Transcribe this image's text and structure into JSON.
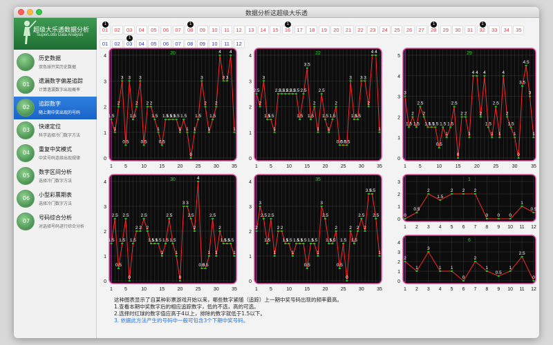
{
  "window": {
    "title": "数据分析这超级大乐透"
  },
  "logo": {
    "title": "超级大乐透数据分析",
    "subtitle": "SuperLotto Data Analysis"
  },
  "nav": [
    {
      "label": "历史数据",
      "sub": "双色球开奖历史数据",
      "icon": "clock-icon",
      "glyph": ""
    },
    {
      "label": "遗漏数字偏差追踪",
      "sub": "计算遗漏数字出现概率",
      "icon": "omission-icon",
      "glyph": "01"
    },
    {
      "label": "追踪数字",
      "sub": "随上期中奖出现的号码",
      "icon": "tracking-icon",
      "glyph": "02"
    },
    {
      "label": "快速定位",
      "sub": "科学选择冷门数字方法",
      "icon": "locate-icon",
      "glyph": "03"
    },
    {
      "label": "重复中奖模式",
      "sub": "中奖号码连续出现规律",
      "icon": "repeat-icon",
      "glyph": "04"
    },
    {
      "label": "数字区间分析",
      "sub": "选择冷门数字方法",
      "icon": "range-icon",
      "glyph": "05"
    },
    {
      "label": "小型彩票期表",
      "sub": "选择冷门数字方法",
      "icon": "table-icon",
      "glyph": "06"
    },
    {
      "label": "号码综合分析",
      "sub": "对选择号码进行综合分析",
      "icon": "analysis-icon",
      "glyph": "07"
    }
  ],
  "active_nav_index": 2,
  "front_numbers": [
    "01",
    "02",
    "03",
    "04",
    "05",
    "06",
    "07",
    "08",
    "09",
    "10",
    "11",
    "12",
    "13",
    "14",
    "15",
    "16",
    "17",
    "18",
    "19",
    "20",
    "21",
    "22",
    "23",
    "24",
    "25",
    "26",
    "27",
    "28",
    "29",
    "30",
    "31",
    "32",
    "33",
    "34",
    "35"
  ],
  "back_numbers": [
    "01",
    "02",
    "03",
    "04",
    "05",
    "06",
    "07",
    "08",
    "09",
    "10",
    "11",
    "12"
  ],
  "front_markers": [
    {
      "number": "01",
      "label": "1"
    },
    {
      "number": "08",
      "label": "1"
    },
    {
      "number": "16",
      "label": "1"
    },
    {
      "number": "28",
      "label": "1"
    },
    {
      "number": "32",
      "label": "1"
    }
  ],
  "back_markers": [
    {
      "number": "03",
      "label": "1"
    }
  ],
  "colors": {
    "red": "#e33333",
    "blue": "#2233cc",
    "accent": "#1a64c8",
    "chart_bg": "#0c0c0c",
    "chart_border": "#e64aa0",
    "line": "#ff2a2a",
    "label": "#ffffff",
    "marker": "#19c21e"
  },
  "chart_data": [
    {
      "type": "line",
      "title": "20",
      "xticks": [
        1,
        5,
        10,
        15,
        20,
        25,
        30,
        35
      ],
      "ylim": [
        0,
        4
      ],
      "yticks": [
        0,
        1,
        2,
        3,
        4
      ],
      "values": [
        1.5,
        1,
        2,
        3,
        0.5,
        3,
        1.5,
        2,
        3,
        0.5,
        2,
        2,
        1.5,
        1,
        0.5,
        1.5,
        1.5,
        1.5,
        1.5,
        1,
        1.5,
        1,
        0,
        1,
        1.5,
        3,
        2,
        1,
        1.5,
        2,
        4,
        3,
        3,
        4,
        1
      ]
    },
    {
      "type": "line",
      "title": "22",
      "xticks": [
        1,
        5,
        10,
        15,
        20,
        25,
        30,
        35
      ],
      "ylim": [
        0,
        4
      ],
      "yticks": [
        0,
        1,
        2,
        3,
        4
      ],
      "values": [
        2.5,
        2,
        3,
        1.5,
        1.5,
        1,
        2.5,
        2.5,
        2.5,
        2.5,
        2.5,
        2.5,
        1.5,
        2.5,
        3.5,
        1.5,
        2,
        1,
        2.5,
        1.5,
        1,
        1.5,
        2,
        0.5,
        0.5,
        0.5,
        3,
        1.5,
        1.5,
        3,
        3,
        2,
        4,
        4,
        1
      ]
    },
    {
      "type": "line",
      "title": "29",
      "xticks": [
        1,
        5,
        10,
        15,
        20,
        25,
        30,
        35
      ],
      "ylim": [
        0,
        5
      ],
      "yticks": [
        0,
        1,
        2,
        3,
        4,
        5
      ],
      "values": [
        3,
        1.5,
        2,
        1.5,
        2.5,
        2,
        1.5,
        1.5,
        1.5,
        0.5,
        1.5,
        1,
        1.5,
        2.5,
        0,
        2,
        2,
        1,
        4,
        4,
        2,
        4,
        1.5,
        1,
        2.5,
        1,
        4,
        2,
        1.5,
        1,
        0,
        3.5,
        4.5,
        3,
        1
      ]
    },
    {
      "type": "line",
      "title": "30",
      "xticks": [
        1,
        5,
        10,
        15,
        20,
        25,
        30,
        35
      ],
      "ylim": [
        0,
        4
      ],
      "yticks": [
        0,
        1,
        2,
        3,
        4
      ],
      "values": [
        1.5,
        2.5,
        0.5,
        1.5,
        2.5,
        0,
        1.5,
        2,
        2,
        2.5,
        2,
        1.5,
        1.5,
        1.5,
        1,
        1.5,
        2.5,
        1.5,
        1,
        0,
        3,
        3,
        2.5,
        2,
        4,
        0.5,
        0.5,
        1,
        2.5,
        1,
        2,
        1.5,
        1.5,
        1.5,
        1
      ]
    },
    {
      "type": "line",
      "title": "35",
      "xticks": [
        1,
        5,
        10,
        15,
        20,
        25,
        30,
        35
      ],
      "ylim": [
        0,
        4
      ],
      "yticks": [
        0,
        1,
        2,
        3,
        4
      ],
      "values": [
        2,
        3,
        2.5,
        1.5,
        2.5,
        1,
        2,
        2,
        1.5,
        1.5,
        1,
        1.5,
        1.5,
        1.5,
        0.5,
        1.5,
        1.5,
        1,
        3,
        2.5,
        1.5,
        1.5,
        2,
        0.5,
        1.5,
        0,
        2,
        1.5,
        2,
        2.5,
        2,
        3.5,
        3.5,
        2.5,
        1
      ]
    },
    {
      "type": "line",
      "title": "1",
      "xticks": [
        1,
        2,
        3,
        4,
        5,
        6,
        7,
        8,
        9,
        10,
        11,
        12
      ],
      "ylim": [
        0,
        3
      ],
      "yticks": [
        0,
        1,
        2,
        3
      ],
      "values": [
        0,
        0.5,
        2,
        1.5,
        2,
        2,
        2,
        0,
        0,
        0,
        1,
        0.5
      ]
    },
    {
      "type": "line",
      "title": "6",
      "xticks": [
        1,
        2,
        3,
        4,
        5,
        6,
        7,
        8,
        9,
        10,
        11,
        12
      ],
      "ylim": [
        0,
        4
      ],
      "yticks": [
        0,
        1,
        2,
        3,
        4
      ],
      "values": [
        2,
        1,
        3,
        1,
        1,
        0,
        2,
        1,
        0.5,
        1,
        2.5,
        0
      ]
    }
  ],
  "notes": [
    "这种图表显示了自某种彩票游戏开始以来，哪些数字紧随（追踪）上一期中奖号码出现的频率最高。",
    "1.查看本期中奖数字后的相应追踪数字，低的不选，高的可选。",
    "2.选择时红球的数字值应高于4以上，排除的数字就低于1.5以下。",
    "3. 依据此方法产生的号码中一般可包含3个下期中奖号码。"
  ]
}
